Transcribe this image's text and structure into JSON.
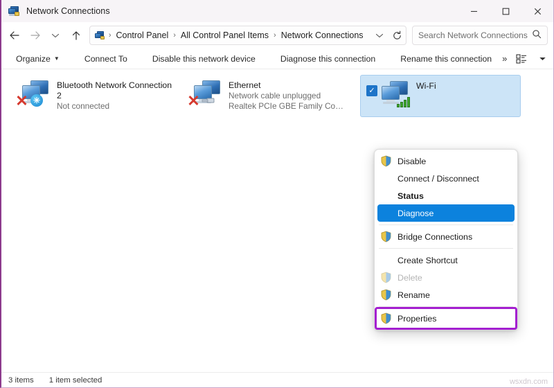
{
  "window": {
    "title": "Network Connections",
    "title_icon": "network-connections-icon",
    "controls": {
      "minimize": "minimize-icon",
      "maximize": "maximize-icon",
      "close": "close-icon"
    }
  },
  "nav": {
    "back": "back-arrow-icon",
    "forward": "forward-arrow-icon",
    "recent": "chevron-down-icon",
    "up": "up-arrow-icon",
    "breadcrumb": [
      "Control Panel",
      "All Control Panel Items",
      "Network Connections"
    ],
    "breadcrumb_separator": "›",
    "address_chevron": "chevron-down-icon",
    "refresh": "refresh-icon"
  },
  "search": {
    "placeholder": "Search Network Connections",
    "value": "",
    "icon": "search-icon"
  },
  "toolbar": {
    "organize": "Organize",
    "connect_to": "Connect To",
    "disable_device": "Disable this network device",
    "diagnose_connection": "Diagnose this connection",
    "rename_connection": "Rename this connection",
    "overflow": "»",
    "view_icon": "list-view-icon",
    "view_caret": "chevron-down-icon",
    "preview_pane_icon": "preview-pane-icon",
    "help_icon": "help-icon",
    "help_glyph": "?"
  },
  "connections": [
    {
      "name": "Bluetooth Network Connection 2",
      "status": "Not connected",
      "adapter": "",
      "selected": false,
      "icon": "bluetooth-network-icon",
      "badge": "bluetooth-badge-icon",
      "error": "red-x-icon"
    },
    {
      "name": "Ethernet",
      "status": "Network cable unplugged",
      "adapter": "Realtek PCIe GBE Family Contr...",
      "selected": false,
      "icon": "ethernet-network-icon",
      "badge": "cable-badge-icon",
      "error": "red-x-icon"
    },
    {
      "name": "Wi-Fi",
      "status": "",
      "adapter": "",
      "selected": true,
      "icon": "wifi-network-icon",
      "badge": "signal-bars-icon",
      "checkbox": "checked-checkbox-icon"
    }
  ],
  "context_menu": {
    "items": [
      {
        "label": "Disable",
        "shield": true,
        "state": "normal"
      },
      {
        "label": "Connect / Disconnect",
        "shield": false,
        "state": "normal"
      },
      {
        "label": "Status",
        "shield": false,
        "state": "bold"
      },
      {
        "label": "Diagnose",
        "shield": false,
        "state": "highlighted"
      },
      {
        "separator": true
      },
      {
        "label": "Bridge Connections",
        "shield": true,
        "state": "normal"
      },
      {
        "separator": true
      },
      {
        "label": "Create Shortcut",
        "shield": false,
        "state": "normal"
      },
      {
        "label": "Delete",
        "shield": true,
        "state": "disabled"
      },
      {
        "label": "Rename",
        "shield": true,
        "state": "normal"
      },
      {
        "separator": true
      },
      {
        "label": "Properties",
        "shield": true,
        "state": "annotated"
      }
    ]
  },
  "status_bar": {
    "item_count": "3 items",
    "selection": "1 item selected"
  },
  "watermark": "wsxdn.com",
  "colors": {
    "accent_blue": "#0c82dd",
    "annotation_purple": "#a41fd0",
    "selection_blue": "#cce4f7",
    "window_edge_purple": "#8d3a8d",
    "help_blue": "#1878c8"
  }
}
